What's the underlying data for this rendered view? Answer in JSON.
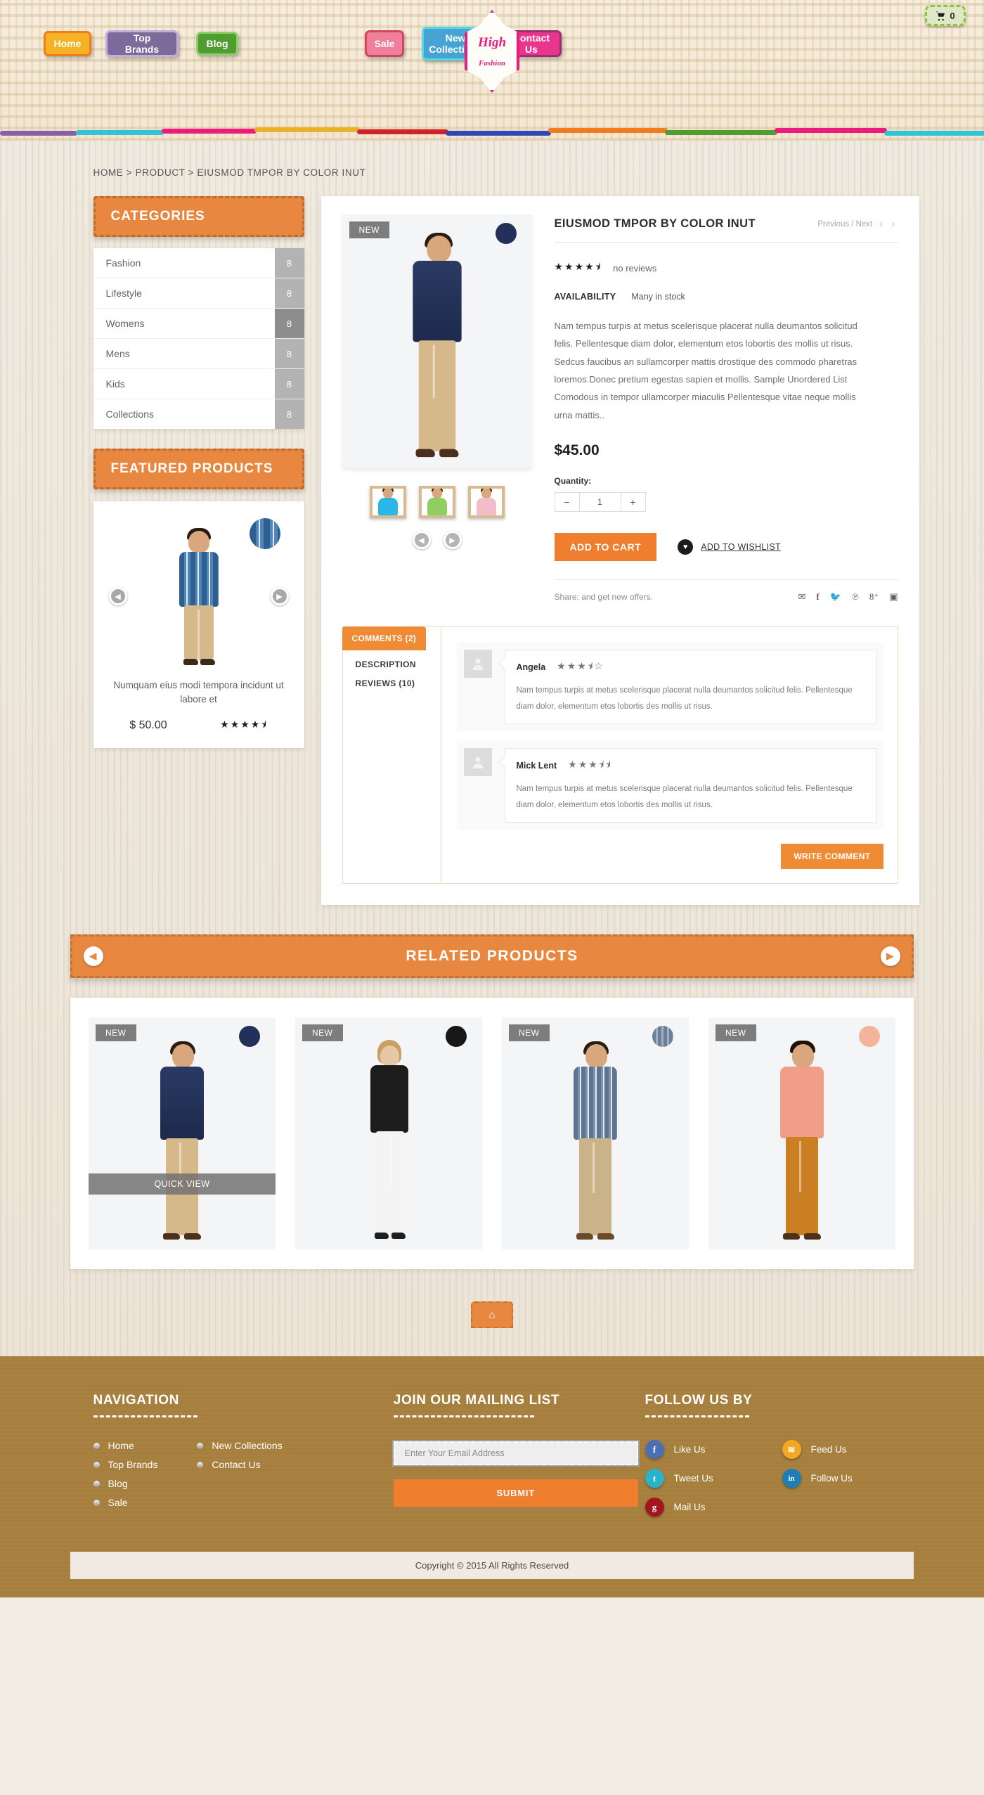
{
  "header": {
    "cart": {
      "icon": "cart-icon",
      "count": "0"
    },
    "logo": {
      "line1": "High",
      "line2": "Fashion"
    },
    "nav": [
      {
        "label": "Home"
      },
      {
        "label": "Top Brands"
      },
      {
        "label": "Blog"
      },
      {
        "label": "Sale"
      },
      {
        "label": "New Collections"
      },
      {
        "label": "Contact Us"
      }
    ]
  },
  "breadcrumb": "HOME > PRODUCT > EIUSMOD TMPOR BY COLOR INUT",
  "sidebar": {
    "categories_title": "CATEGORIES",
    "categories": [
      {
        "name": "Fashion",
        "count": "8"
      },
      {
        "name": "Lifestyle",
        "count": "8"
      },
      {
        "name": "Womens",
        "count": "8"
      },
      {
        "name": "Mens",
        "count": "8"
      },
      {
        "name": "Kids",
        "count": "8"
      },
      {
        "name": "Collections",
        "count": "8"
      }
    ],
    "featured_title": "FEATURED PRODUCTS",
    "featured": {
      "title": "Numquam eius modi tempora incidunt ut labore et",
      "price": "$ 50.00",
      "stars": "★★★★⯨",
      "prev_icon": "chevron-left-icon",
      "next_icon": "chevron-right-icon"
    }
  },
  "product": {
    "badge": "NEW",
    "title": "EIUSMOD TMPOR BY COLOR INUT",
    "prevnext": "Previous / Next",
    "stars": "★★★★⯨",
    "reviews_text": "no reviews",
    "availability_label": "AVAILABILITY",
    "availability_value": "Many in stock",
    "description": "Nam tempus turpis at metus scelerisque placerat nulla deumantos solicitud felis. Pellentesque diam dolor, elementum etos lobortis des mollis ut risus. Sedcus faucibus an sullamcorper mattis drostique des commodo pharetras loremos.Donec pretium egestas sapien et mollis. Sample Unordered List Comodous in tempor ullamcorper miaculis Pellentesque vitae neque mollis urna mattis..",
    "price": "$45.00",
    "quantity_label": "Quantity:",
    "quantity_value": "1",
    "minus_label": "−",
    "plus_label": "+",
    "add_to_cart": "ADD TO CART",
    "add_to_wishlist": "ADD TO WISHLIST",
    "share_text": "Share: and get new offers.",
    "share_icons": [
      "mail-icon",
      "facebook-icon",
      "twitter-icon",
      "pinterest-icon",
      "google-plus-icon",
      "instagram-icon"
    ]
  },
  "tabs": {
    "active": "COMMENTS (2)",
    "items": [
      {
        "label": "DESCRIPTION"
      },
      {
        "label": "REVIEWS (10)"
      }
    ],
    "write_comment": "WRITE COMMENT"
  },
  "comments": [
    {
      "name": "Angela",
      "stars": "★★★⯨☆",
      "text": "Nam tempus turpis at metus scelerisque placerat nulla deumantos solicitud felis. Pellentesque diam dolor, elementum etos lobortis des mollis ut risus."
    },
    {
      "name": "Mick Lent",
      "stars": "★★★⯨⯨",
      "text": "Nam tempus turpis at metus scelerisque placerat nulla deumantos solicitud felis. Pellentesque diam dolor, elementum etos lobortis des mollis ut risus."
    }
  ],
  "related": {
    "title": "RELATED PRODUCTS",
    "prev_icon": "chevron-left-icon",
    "next_icon": "chevron-right-icon",
    "quick_view": "QUICK VIEW",
    "items": [
      {
        "badge": "NEW",
        "swatch": "#22305a",
        "shirt": "#22305a",
        "pants": "#d6b98b",
        "has_quick_view": true
      },
      {
        "badge": "NEW",
        "swatch": "#181818",
        "shirt": "#1d1d1d",
        "pants": "#f2f2f2",
        "has_quick_view": false
      },
      {
        "badge": "NEW",
        "swatch": "#6d7f96",
        "shirt": "#5d7390",
        "pants": "#cbb389",
        "has_quick_view": false
      },
      {
        "badge": "NEW",
        "swatch": "#f3b49a",
        "shirt": "#f09e87",
        "pants": "#c97f22",
        "has_quick_view": false
      }
    ]
  },
  "footer": {
    "to_top_icon": "arrow-up-icon",
    "navigation_title": "NAVIGATION",
    "nav_col1": [
      {
        "label": "Home"
      },
      {
        "label": "Top Brands"
      },
      {
        "label": "Blog"
      },
      {
        "label": "Sale"
      }
    ],
    "nav_col2": [
      {
        "label": "New Collections"
      },
      {
        "label": "Contact Us"
      }
    ],
    "mailing_title": "JOIN OUR MAILING LIST",
    "email_placeholder": "Enter Your Email Address",
    "submit_label": "SUBMIT",
    "follow_title": "FOLLOW US BY",
    "social": [
      {
        "label": "Like Us",
        "icon": "facebook-icon",
        "glyph": "f",
        "color": "#4a6fb5"
      },
      {
        "label": "Feed Us",
        "icon": "rss-icon",
        "glyph": "≋",
        "color": "#f5a623"
      },
      {
        "label": "Tweet Us",
        "icon": "twitter-icon",
        "glyph": "t",
        "color": "#2bb3c9"
      },
      {
        "label": "Follow Us",
        "icon": "linkedin-icon",
        "glyph": "in",
        "color": "#1d7fb5"
      },
      {
        "label": "Mail Us",
        "icon": "google-icon",
        "glyph": "g",
        "color": "#a3151f"
      }
    ],
    "copyright": "Copyright © 2015 All Rights Reserved"
  },
  "colors": {
    "accent": "#e8873f",
    "cart_button": "#ef7f2e",
    "footer_bg": "#a8813f",
    "brand_pink": "#ec1c7d"
  }
}
